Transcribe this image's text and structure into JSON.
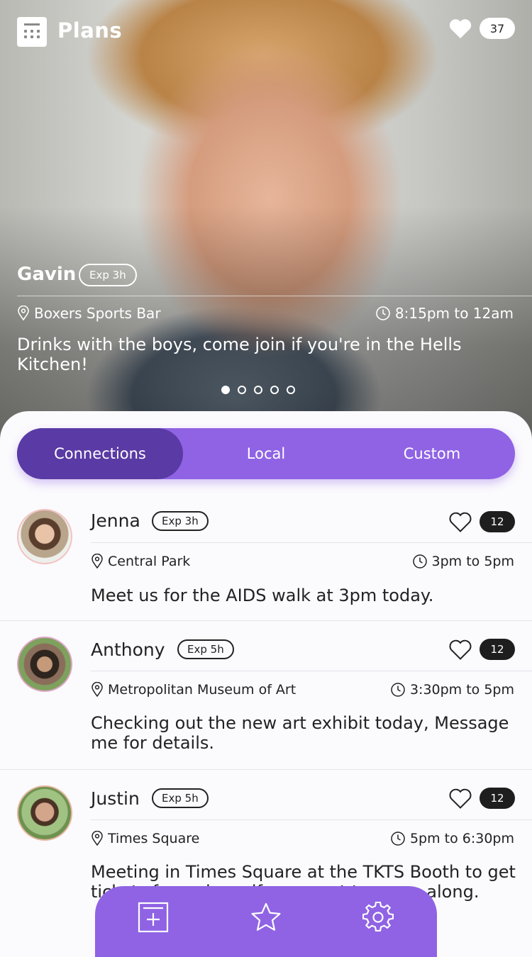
{
  "header": {
    "title": "Plans",
    "likes_count": "37"
  },
  "hero": {
    "name": "Gavin",
    "expiry": "Exp 3h",
    "location": "Boxers Sports Bar",
    "time": "8:15pm to 12am",
    "description": "Drinks with the boys, come join if you're in the Hells Kitchen!",
    "page_indicator": {
      "total": 5,
      "active": 1
    }
  },
  "tabs": [
    {
      "label": "Connections",
      "active": true
    },
    {
      "label": "Local",
      "active": false
    },
    {
      "label": "Custom",
      "active": false
    }
  ],
  "plans": [
    {
      "name": "Jenna",
      "expiry": "Exp 3h",
      "likes": "12",
      "location": "Central Park",
      "time": "3pm to 5pm",
      "description": "Meet us for the AIDS walk at 3pm today."
    },
    {
      "name": "Anthony",
      "expiry": "Exp 5h",
      "likes": "12",
      "location": "Metropolitan Museum of Art",
      "time": "3:30pm to 5pm",
      "description": "Checking out the new art exhibit today, Message me for details."
    },
    {
      "name": "Justin",
      "expiry": "Exp 5h",
      "likes": "12",
      "location": "Times Square",
      "time": "5pm to 6:30pm",
      "description": "Meeting in Times Square at the TKTS Booth to get tickets for a show, if you want to come along."
    }
  ],
  "bottom_nav": {
    "items": [
      "add-plan-icon",
      "favorites-star-icon",
      "settings-gear-icon"
    ]
  },
  "colors": {
    "accent": "#8f63e4",
    "accent_dark": "#5a3aa4",
    "text": "#222222",
    "background": "#fbfafd"
  }
}
